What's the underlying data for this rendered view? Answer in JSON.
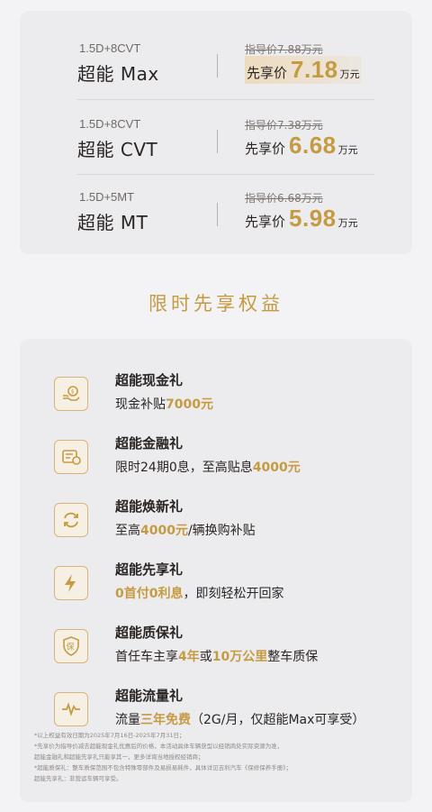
{
  "prices": [
    {
      "spec": "1.5D+8CVT",
      "model": "超能 Max",
      "guide": "指导价7.88万元",
      "promo_label": "先享价",
      "promo_value": "7.18",
      "unit": "万元"
    },
    {
      "spec": "1.5D+8CVT",
      "model": "超能 CVT",
      "guide": "指导价7.38万元",
      "promo_label": "先享价",
      "promo_value": "6.68",
      "unit": "万元"
    },
    {
      "spec": "1.5D+5MT",
      "model": "超能 MT",
      "guide": "指导价6.68万元",
      "promo_label": "先享价",
      "promo_value": "5.98",
      "unit": "万元"
    }
  ],
  "section_title": "限时先享权益",
  "benefits": [
    {
      "icon": "cash-gift-icon",
      "title": "超能现金礼",
      "desc": [
        {
          "t": "现金补贴"
        },
        {
          "t": "7000元",
          "hl": true
        }
      ]
    },
    {
      "icon": "finance-icon",
      "title": "超能金融礼",
      "desc": [
        {
          "t": "限时24期0息，至高贴息"
        },
        {
          "t": "4000元",
          "hl": true
        }
      ]
    },
    {
      "icon": "trade-in-icon",
      "title": "超能焕新礼",
      "desc": [
        {
          "t": "至高"
        },
        {
          "t": "4000元",
          "hl": true
        },
        {
          "t": "/辆换购补贴"
        }
      ]
    },
    {
      "icon": "lightning-icon",
      "title": "超能先享礼",
      "desc": [
        {
          "t": "0首付0利息",
          "hl": true
        },
        {
          "t": "，即刻轻松开回家"
        }
      ]
    },
    {
      "icon": "warranty-shield-icon",
      "title": "超能质保礼",
      "desc": [
        {
          "t": "首任车主享"
        },
        {
          "t": "4年",
          "hl": true
        },
        {
          "t": "或"
        },
        {
          "t": "10万公里",
          "hl": true
        },
        {
          "t": "整车质保"
        }
      ]
    },
    {
      "icon": "data-pulse-icon",
      "title": "超能流量礼",
      "desc": [
        {
          "t": "流量"
        },
        {
          "t": "三年免费",
          "hl": true
        },
        {
          "t": "（2G/月，仅超能Max可享受）"
        }
      ]
    }
  ],
  "footnotes": [
    "*以上权益有效日期为2025年7月16日-2025年7月31日；",
    "*先享价为指导价减去超能现金礼优惠后的价格，本活动具体车辆获型以经销商处实际资源为准，",
    "超能金融礼和超能先享礼只能享其一，更多详询当地授权经销商；",
    "*超能质保礼：整车质保范围不包含特殊零部件及易损易耗件，具体详见吉利汽车《保修保养手册》；",
    "超能先享礼：非营运车辆可享受。"
  ],
  "colors": {
    "accent": "#c59b42",
    "card": "#ecebee",
    "background": "#f3f2f4"
  }
}
